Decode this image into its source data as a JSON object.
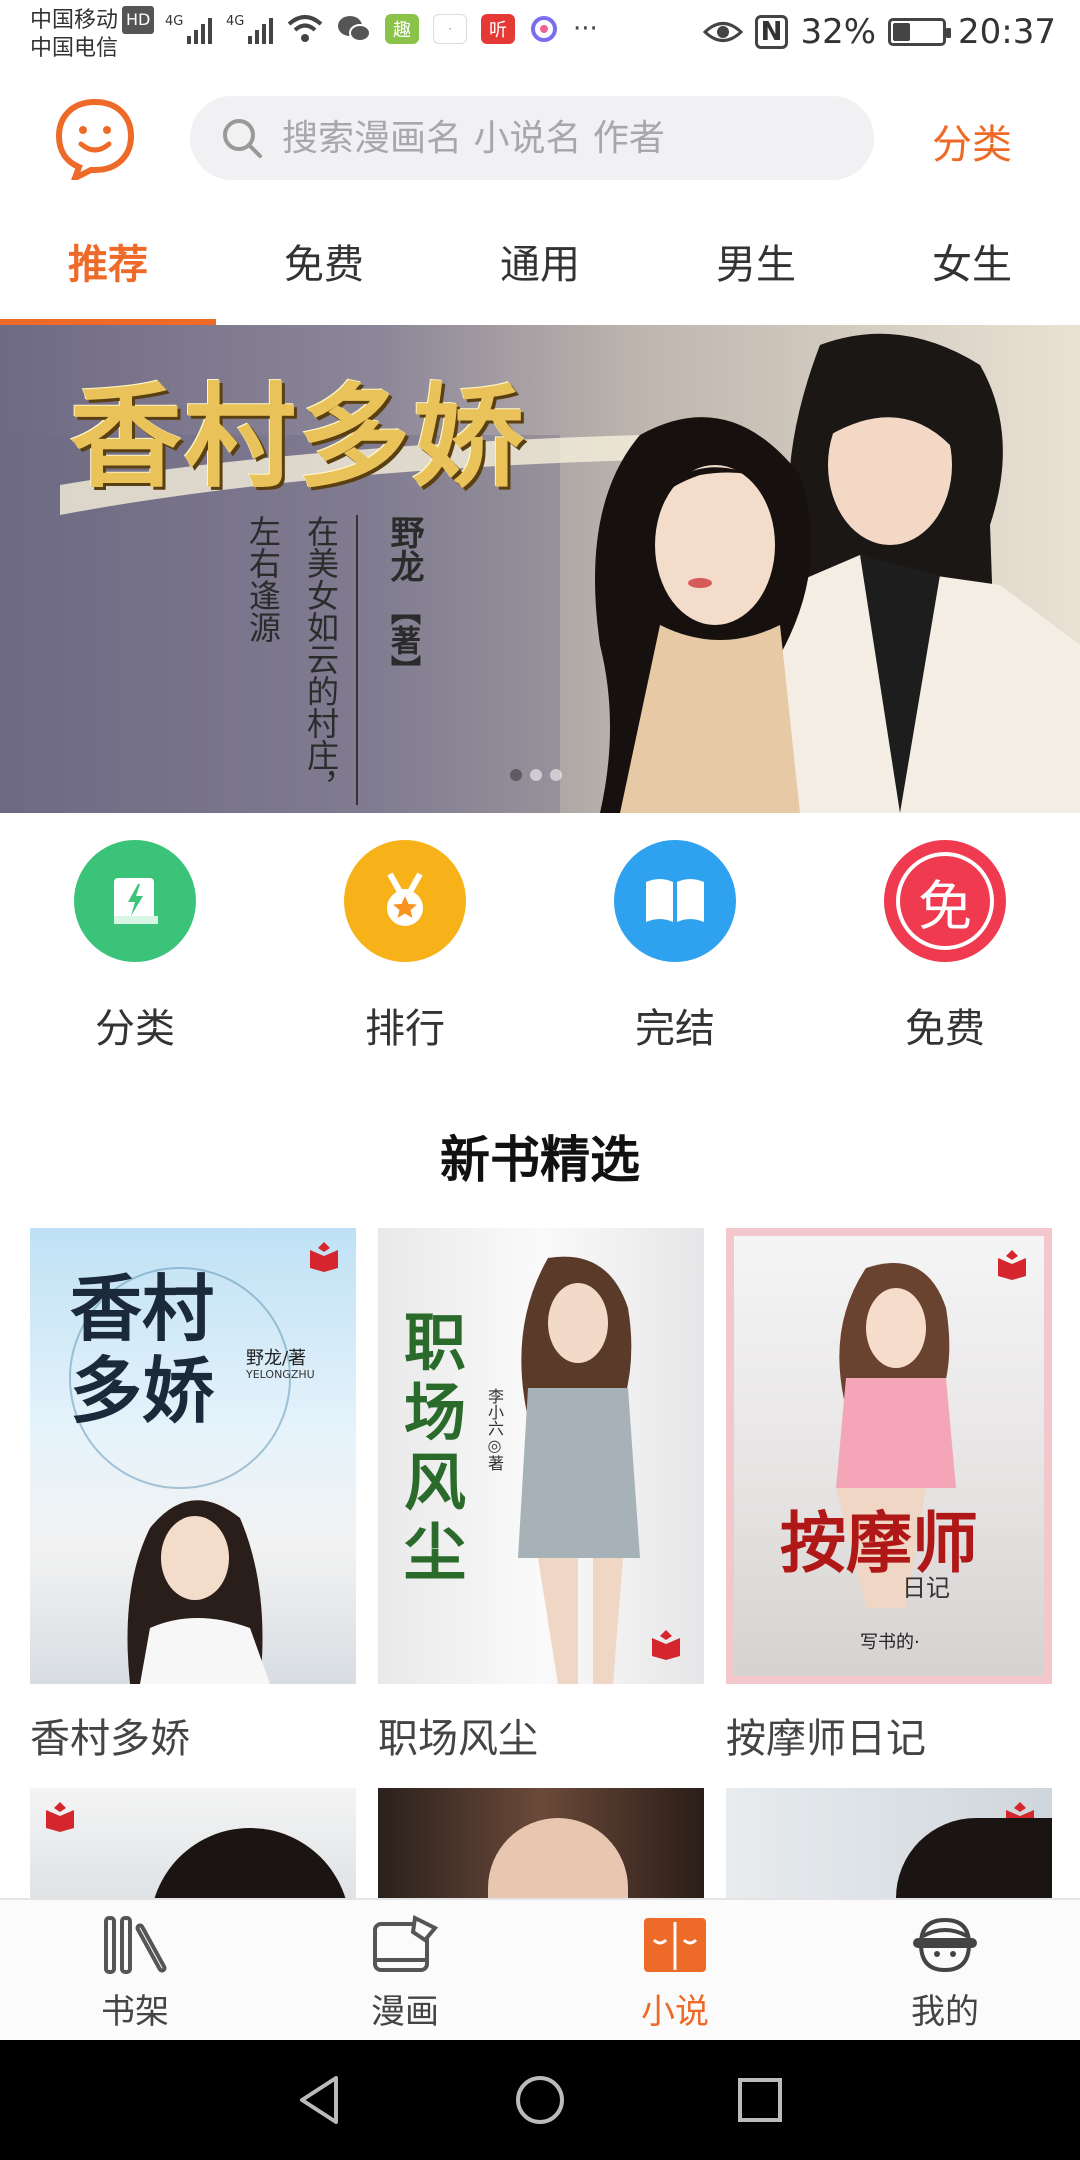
{
  "status_bar": {
    "carrier1": "中国移动",
    "hd": "HD",
    "carrier2": "中国电信",
    "net1": "4G",
    "net2": "4G",
    "more": "···",
    "nfc": "N",
    "battery": "32%",
    "battery_level": 0.32,
    "time": "20:37"
  },
  "header": {
    "search_placeholder": "搜索漫画名 小说名 作者",
    "category_link": "分类"
  },
  "tabs": [
    {
      "label": "推荐",
      "active": true
    },
    {
      "label": "免费",
      "active": false
    },
    {
      "label": "通用",
      "active": false
    },
    {
      "label": "男生",
      "active": false
    },
    {
      "label": "女生",
      "active": false
    }
  ],
  "banner": {
    "title": "香村多娇",
    "author": "野龙",
    "author_mark": "【著】",
    "tagline": "在美女如云的村庄，",
    "tagline2": "左右逢源"
  },
  "quick_entries": [
    {
      "label": "分类",
      "icon": "book-bolt-icon",
      "color": "#3cc37a"
    },
    {
      "label": "排行",
      "icon": "medal-icon",
      "color": "#f7b219"
    },
    {
      "label": "完结",
      "icon": "open-book-icon",
      "color": "#2fa2ef"
    },
    {
      "label": "免费",
      "icon": "free-icon",
      "color": "#f03a50",
      "glyph": "免"
    }
  ],
  "section": {
    "title": "新书精选"
  },
  "books": [
    {
      "title": "香村多娇",
      "cover_title": "香村多娇",
      "cover_author": "野龙/著",
      "cover_author_en": "YELONGZHU"
    },
    {
      "title": "职场风尘",
      "cover_title": "职场风尘",
      "cover_author": "李小六◎著"
    },
    {
      "title": "按摩师日记",
      "cover_title": "按摩师",
      "cover_sub": "日记",
      "cover_author": "写书的·"
    }
  ],
  "bottom_nav": [
    {
      "label": "书架",
      "icon": "bookshelf-icon",
      "active": false
    },
    {
      "label": "漫画",
      "icon": "comic-icon",
      "active": false
    },
    {
      "label": "小说",
      "icon": "novel-icon",
      "active": true
    },
    {
      "label": "我的",
      "icon": "profile-icon",
      "active": false
    }
  ],
  "system_nav": {
    "back": "back-icon",
    "home": "home-icon",
    "recents": "recents-icon"
  },
  "colors": {
    "accent": "#ee6a28",
    "search_bg": "#f1f1f3"
  }
}
